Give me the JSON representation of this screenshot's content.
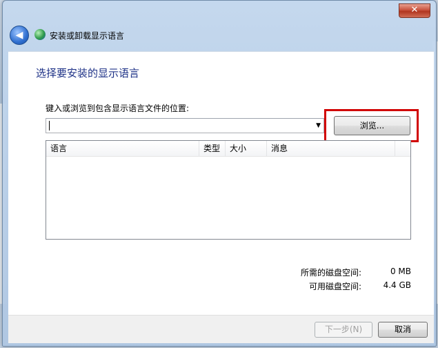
{
  "window": {
    "title": "安装或卸载显示语言",
    "close_glyph": "✕"
  },
  "nav": {
    "back_glyph": "◀"
  },
  "main": {
    "heading": "选择要安装的显示语言",
    "path_label": "键入或浏览到包含显示语言文件的位置:",
    "path_value": "",
    "browse_label": "浏览...",
    "list_columns": [
      "语言",
      "类型",
      "大小",
      "消息"
    ],
    "disk": {
      "required_label": "所需的磁盘空间:",
      "required_value": "0 MB",
      "available_label": "可用磁盘空间:",
      "available_value": "4.4 GB"
    }
  },
  "footer": {
    "next_label": "下一步(N)",
    "cancel_label": "取消"
  },
  "colors": {
    "heading": "#1e3287",
    "highlight": "#d10000"
  },
  "icons": [
    "back-arrow-icon",
    "globe-icon",
    "close-icon",
    "dropdown-arrow-icon"
  ]
}
